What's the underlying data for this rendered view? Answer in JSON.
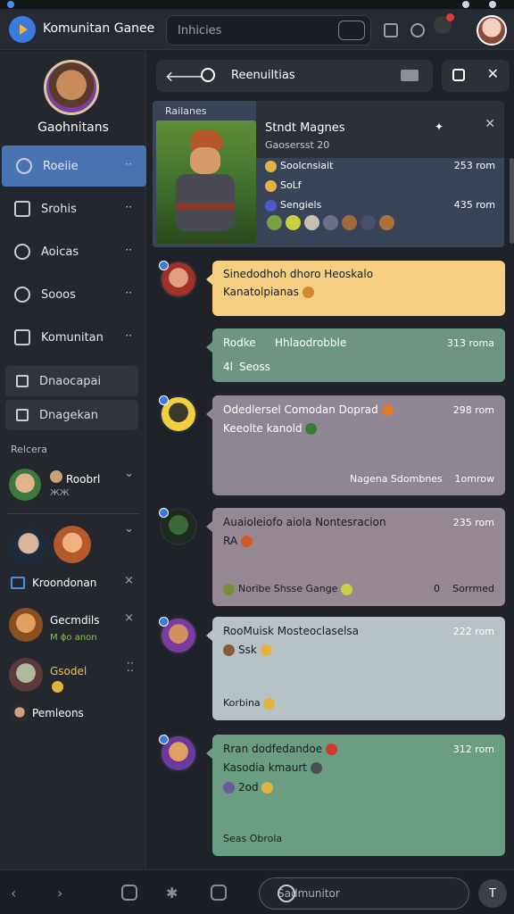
{
  "app": {
    "title": "Komunitan Ganee"
  },
  "topbar": {
    "search_value": "Inhicies"
  },
  "sidebar": {
    "profile_name": "Gaohnitans",
    "nav": [
      {
        "label": "Roeiie",
        "active": true
      },
      {
        "label": "Srohis"
      },
      {
        "label": "Aoicas"
      },
      {
        "label": "Sooos"
      },
      {
        "label": "Komunitan"
      }
    ],
    "chips": [
      {
        "label": "Dnaocapai"
      },
      {
        "label": "Dnagekan"
      }
    ],
    "section_label": "Relcera",
    "contacts": [
      {
        "name": "Roobrl",
        "sub": "ЖЖ"
      },
      {
        "name": "Kroondonan"
      },
      {
        "name": "Gecmdils",
        "sub": "M ɸo anon"
      },
      {
        "name": "Gsodel"
      },
      {
        "name": "Pemleons"
      }
    ]
  },
  "chat": {
    "title": "Reenuiltias",
    "feature": {
      "tag": "Railanes",
      "title": "Stndt Magnes",
      "subtitle": "Gaosersst 20",
      "rows": [
        {
          "text": "Soolcnsiait",
          "time": "253 rom"
        },
        {
          "text": "SoԼf",
          "time": ""
        },
        {
          "text": "Sengiels",
          "time": "435 rom"
        }
      ]
    },
    "messages": [
      {
        "line1": "Sinedodhoh dhoro Heoskalo",
        "line2": "Kanatolpianas"
      },
      {
        "line1": "Rodke",
        "line1b": "Hhlaodrobble",
        "time": "313 roma",
        "line2": "Seoss",
        "marker": "4l"
      },
      {
        "line1": "Odedlersel Comodan Doprad",
        "time": "298 rom",
        "line2": "Keeolte kanold",
        "footer": "Nagena Sdombnes",
        "footer_time": "1omrow"
      },
      {
        "line1": "Auaioleiofo aiola Nontesracion",
        "time": "235 rom",
        "line2": "RA",
        "footer": "Noribe Shsse Gange",
        "footer_num": "0",
        "footer_end": "Sorrmed"
      },
      {
        "line1": "RooMuisk Mosteoclaselsa",
        "time": "222 rom",
        "line2": "Ssk",
        "footer": "Korbina"
      },
      {
        "line1": "Rran dodfedandoe",
        "time": "312 rom",
        "line2": "Kasodia kmaurt",
        "line3": "2od",
        "footer": "Seas Obrola"
      }
    ]
  },
  "composer": {
    "placeholder": "Sadmunitor"
  },
  "colors": {
    "accent": "#4a73b4",
    "bubble_yellow": "#f6cf82",
    "bubble_green": "#6e9584",
    "bubble_purple": "#8f8694",
    "bubble_mauve": "#968892",
    "bubble_light": "#b6c2c6",
    "bubble_teal": "#6a9d82"
  }
}
